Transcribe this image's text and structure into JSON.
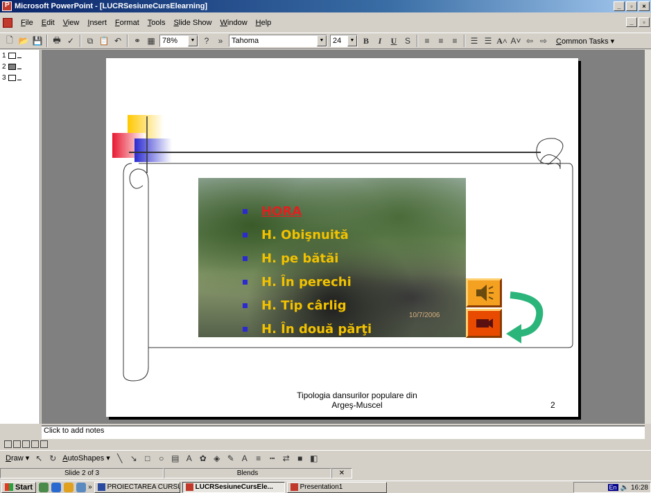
{
  "window": {
    "title": "Microsoft PowerPoint - [LUCRSesiuneCursElearning]"
  },
  "menu": [
    "File",
    "Edit",
    "View",
    "Insert",
    "Format",
    "Tools",
    "Slide Show",
    "Window",
    "Help"
  ],
  "toolbar": {
    "zoom": "78%",
    "font": "Tahoma",
    "font_size": "24",
    "common_tasks": "Common Tasks ▾"
  },
  "outline": {
    "slides": [
      "1",
      "2",
      "3"
    ]
  },
  "slide": {
    "bullets": [
      "HORA",
      "H. Obişnuită",
      "H. pe bătăi",
      "H. În perechi",
      "H. Tip cârlig",
      "H. În două părţi"
    ],
    "photo_date": "10/7/2006",
    "footer_line1": "Tipologia dansurilor populare din",
    "footer_line2": "Argeş-Muscel",
    "number": "2"
  },
  "notes": {
    "placeholder": "Click to add notes"
  },
  "drawing": {
    "draw": "Draw ▾",
    "autoshapes": "AutoShapes ▾"
  },
  "status": {
    "slide_of": "Slide 2 of 3",
    "design": "Blends"
  },
  "taskbar": {
    "start": "Start",
    "items": [
      "PROIECTAREA CURSUR...",
      "LUCRSesiuneCursEle...",
      "Presentation1"
    ],
    "tray_lang": "En",
    "clock": "16:28"
  },
  "colors": {
    "bullet_text": "#f2c200",
    "hora_text": "#e02020",
    "bullet_square": "#2a2ad0",
    "titlebar": "#0a246a"
  }
}
